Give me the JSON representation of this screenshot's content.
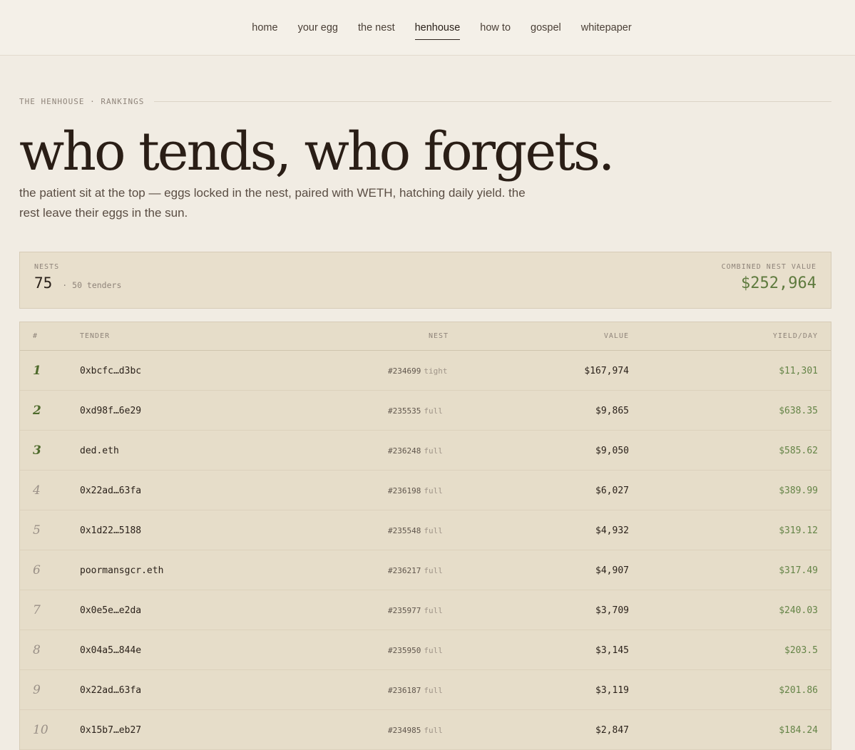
{
  "nav": {
    "items": [
      {
        "label": "home"
      },
      {
        "label": "your egg"
      },
      {
        "label": "the nest"
      },
      {
        "label": "henhouse",
        "active": true
      },
      {
        "label": "how to"
      },
      {
        "label": "gospel"
      },
      {
        "label": "whitepaper"
      }
    ]
  },
  "hero": {
    "eyebrow": "THE HENHOUSE · RANKINGS",
    "title": "who tends, who forgets.",
    "subtitle": "the patient sit at the top — eggs locked in the nest, paired with WETH, hatching daily yield. the rest leave their eggs in the sun."
  },
  "stats": {
    "nests_label": "NESTS",
    "nests_count": "75",
    "tenders": "· 50 tenders",
    "combined_label": "COMBINED NEST VALUE",
    "combined_value": "$252,964"
  },
  "table": {
    "headers": {
      "rank": "#",
      "tender": "TENDER",
      "nest": "NEST",
      "value": "VALUE",
      "yield": "YIELD/DAY"
    },
    "rows": [
      {
        "rank": "1",
        "tender": "0xbcfc…d3bc",
        "nest_id": "#234699",
        "nest_kind": "tight",
        "value": "$167,974",
        "yield": "$11,301"
      },
      {
        "rank": "2",
        "tender": "0xd98f…6e29",
        "nest_id": "#235535",
        "nest_kind": "full",
        "value": "$9,865",
        "yield": "$638.35"
      },
      {
        "rank": "3",
        "tender": "ded.eth",
        "nest_id": "#236248",
        "nest_kind": "full",
        "value": "$9,050",
        "yield": "$585.62"
      },
      {
        "rank": "4",
        "tender": "0x22ad…63fa",
        "nest_id": "#236198",
        "nest_kind": "full",
        "value": "$6,027",
        "yield": "$389.99"
      },
      {
        "rank": "5",
        "tender": "0x1d22…5188",
        "nest_id": "#235548",
        "nest_kind": "full",
        "value": "$4,932",
        "yield": "$319.12"
      },
      {
        "rank": "6",
        "tender": "poormansgcr.eth",
        "nest_id": "#236217",
        "nest_kind": "full",
        "value": "$4,907",
        "yield": "$317.49"
      },
      {
        "rank": "7",
        "tender": "0x0e5e…e2da",
        "nest_id": "#235977",
        "nest_kind": "full",
        "value": "$3,709",
        "yield": "$240.03"
      },
      {
        "rank": "8",
        "tender": "0x04a5…844e",
        "nest_id": "#235950",
        "nest_kind": "full",
        "value": "$3,145",
        "yield": "$203.5"
      },
      {
        "rank": "9",
        "tender": "0x22ad…63fa",
        "nest_id": "#236187",
        "nest_kind": "full",
        "value": "$3,119",
        "yield": "$201.86"
      },
      {
        "rank": "10",
        "tender": "0x15b7…eb27",
        "nest_id": "#234985",
        "nest_kind": "full",
        "value": "$2,847",
        "yield": "$184.24"
      }
    ]
  }
}
